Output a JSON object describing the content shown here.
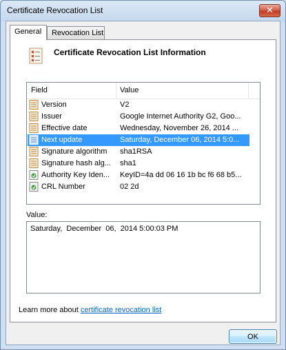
{
  "window": {
    "title": "Certificate Revocation List",
    "close_glyph": "✕"
  },
  "tabs": [
    {
      "label": "General",
      "active": true
    },
    {
      "label": "Revocation List",
      "active": false
    }
  ],
  "header": {
    "title": "Certificate Revocation List Information",
    "icon": "crl-document-icon"
  },
  "list": {
    "columns": [
      "Field",
      "Value"
    ],
    "rows": [
      {
        "field": "Version",
        "value": "V2",
        "icon": "field-doc-icon"
      },
      {
        "field": "Issuer",
        "value": "Google Internet Authority G2, Goo...",
        "icon": "field-doc-icon"
      },
      {
        "field": "Effective date",
        "value": "Wednesday, November 26, 2014 ...",
        "icon": "field-doc-icon"
      },
      {
        "field": "Next update",
        "value": "Saturday, December 06, 2014 5:0...",
        "icon": "field-doc-icon",
        "selected": true
      },
      {
        "field": "Signature algorithm",
        "value": "sha1RSA",
        "icon": "field-doc-icon"
      },
      {
        "field": "Signature hash alg...",
        "value": "sha1",
        "icon": "field-doc-icon"
      },
      {
        "field": "Authority Key Iden...",
        "value": "KeyID=4a dd 06 16 1b bc f6 68 b5...",
        "icon": "extension-icon"
      },
      {
        "field": "CRL Number",
        "value": "02 2d",
        "icon": "extension-icon"
      }
    ]
  },
  "value_panel": {
    "label": "Value:",
    "text": "Saturday,  December  06,  2014 5:00:03 PM"
  },
  "footer": {
    "learn_prefix": "Learn more about ",
    "learn_link": "certificate revocation list"
  },
  "buttons": {
    "ok": "OK"
  },
  "colors": {
    "selection": "#3399ff",
    "link": "#0066cc"
  }
}
